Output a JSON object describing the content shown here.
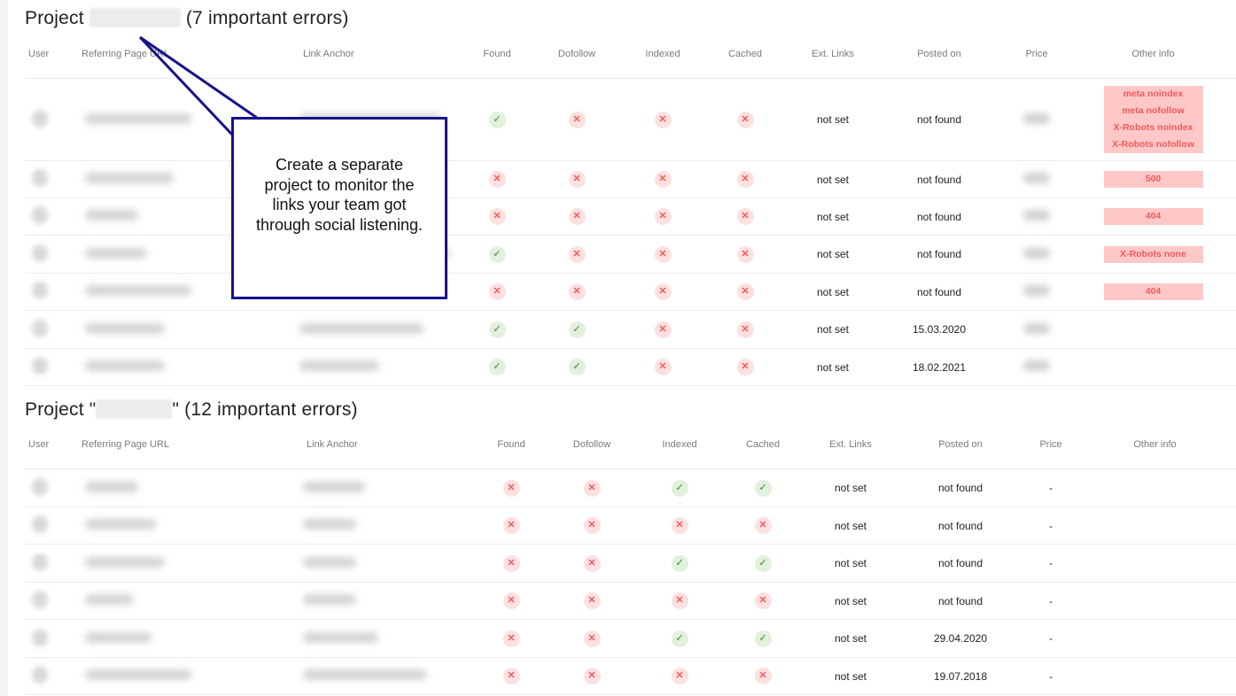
{
  "columns": [
    "User",
    "Referring Page URL",
    "Link Anchor",
    "Found",
    "Dofollow",
    "Indexed",
    "Cached",
    "Ext. Links",
    "Posted on",
    "Price",
    "Other info"
  ],
  "project1": {
    "title_prefix": "Project",
    "title_suffix": "(7 important errors)",
    "header_url_label": "Referring Page URL",
    "rows": [
      {
        "found": "ok",
        "dofollow": "bad",
        "indexed": "bad",
        "cached": "bad",
        "ext_links": "not set",
        "posted_on": "not found",
        "price": "blurred",
        "other_info": [
          "meta noindex",
          "meta nofollow",
          "X-Robots noindex",
          "X-Robots nofollow"
        ]
      },
      {
        "found": "bad",
        "dofollow": "bad",
        "indexed": "bad",
        "cached": "bad",
        "ext_links": "not set",
        "posted_on": "not found",
        "price": "blurred",
        "other_info": [
          "500"
        ]
      },
      {
        "found": "bad",
        "dofollow": "bad",
        "indexed": "bad",
        "cached": "bad",
        "ext_links": "not set",
        "posted_on": "not found",
        "price": "blurred",
        "other_info": [
          "404"
        ]
      },
      {
        "found": "ok",
        "dofollow": "bad",
        "indexed": "bad",
        "cached": "bad",
        "ext_links": "not set",
        "posted_on": "not found",
        "price": "blurred",
        "other_info": [
          "X-Robots none"
        ]
      },
      {
        "found": "bad",
        "dofollow": "bad",
        "indexed": "bad",
        "cached": "bad",
        "ext_links": "not set",
        "posted_on": "not found",
        "price": "blurred",
        "other_info": [
          "404"
        ]
      },
      {
        "found": "ok",
        "dofollow": "ok",
        "indexed": "bad",
        "cached": "bad",
        "ext_links": "not set",
        "posted_on": "15.03.2020",
        "price": "blurred",
        "other_info": []
      },
      {
        "found": "ok",
        "dofollow": "ok",
        "indexed": "bad",
        "cached": "bad",
        "ext_links": "not set",
        "posted_on": "18.02.2021",
        "price": "blurred",
        "other_info": []
      }
    ]
  },
  "project2": {
    "title_prefix": "Project \"",
    "title_suffix": "\" (12 important errors)",
    "rows": [
      {
        "found": "bad",
        "dofollow": "bad",
        "indexed": "ok",
        "cached": "ok",
        "ext_links": "not set",
        "posted_on": "not found",
        "price": "-",
        "other_info": []
      },
      {
        "found": "bad",
        "dofollow": "bad",
        "indexed": "bad",
        "cached": "bad",
        "ext_links": "not set",
        "posted_on": "not found",
        "price": "-",
        "other_info": []
      },
      {
        "found": "bad",
        "dofollow": "bad",
        "indexed": "ok",
        "cached": "ok",
        "ext_links": "not set",
        "posted_on": "not found",
        "price": "-",
        "other_info": []
      },
      {
        "found": "bad",
        "dofollow": "bad",
        "indexed": "bad",
        "cached": "bad",
        "ext_links": "not set",
        "posted_on": "not found",
        "price": "-",
        "other_info": []
      },
      {
        "found": "bad",
        "dofollow": "bad",
        "indexed": "ok",
        "cached": "ok",
        "ext_links": "not set",
        "posted_on": "29.04.2020",
        "price": "-",
        "other_info": []
      },
      {
        "found": "bad",
        "dofollow": "bad",
        "indexed": "bad",
        "cached": "bad",
        "ext_links": "not set",
        "posted_on": "19.07.2018",
        "price": "-",
        "other_info": []
      }
    ]
  },
  "icons": {
    "ok": "✓",
    "bad": "✕"
  },
  "callout": {
    "text": "Create a separate project to monitor the links your team got through social listening.",
    "border_color": "#16128c"
  },
  "colors": {
    "ok_bg": "#e2f0dd",
    "ok_fg": "#6aaa5a",
    "bad_bg": "#fde0e0",
    "bad_fg": "#f25a5a",
    "badge_bg": "#ffc8c8",
    "badge_fg": "#f25a5a"
  }
}
